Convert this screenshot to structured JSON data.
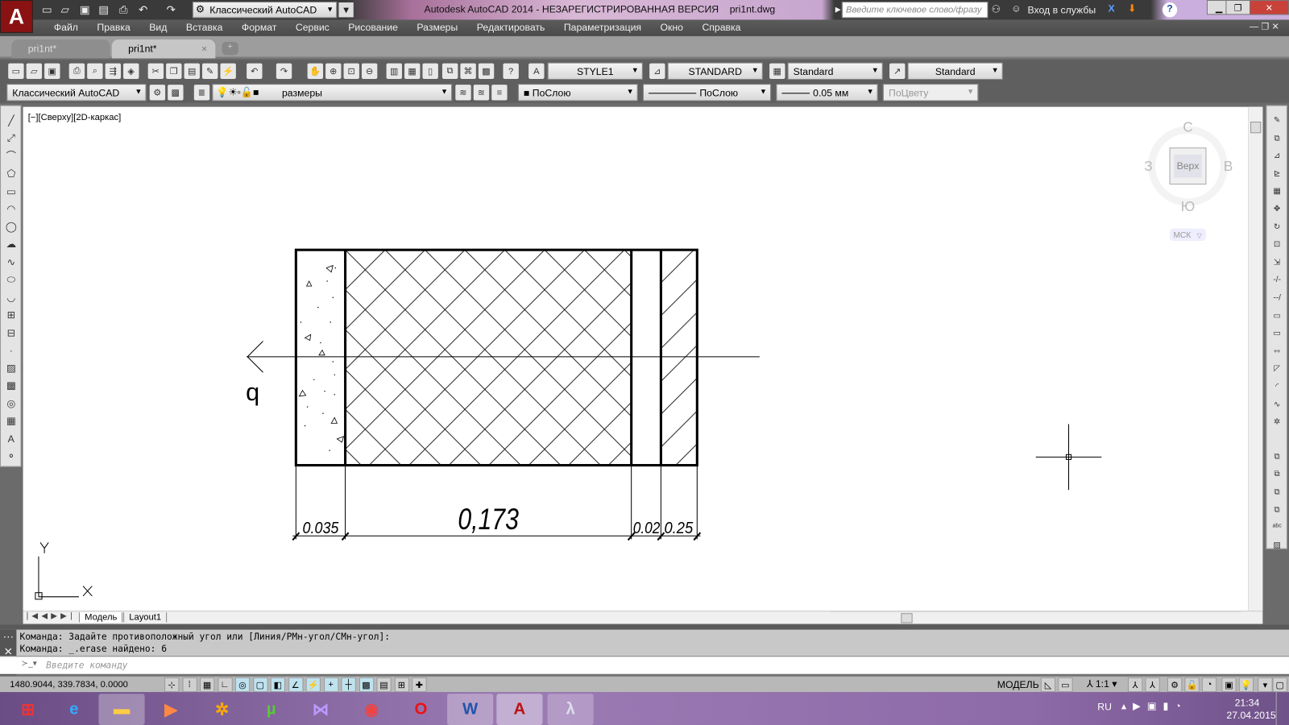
{
  "title_bar": {
    "workspace": "Классический AutoCAD",
    "window_title": "Autodesk AutoCAD 2014 - НЕЗАРЕГИСТРИРОВАННАЯ ВЕРСИЯ    pri1nt.dwg",
    "search_placeholder": "Введите ключевое слово/фразу",
    "sign_in": "Вход в службы",
    "help": "?"
  },
  "menu": [
    "Файл",
    "Правка",
    "Вид",
    "Вставка",
    "Формат",
    "Сервис",
    "Рисование",
    "Размеры",
    "Редактировать",
    "Параметризация",
    "Окно",
    "Справка"
  ],
  "doc_tabs": [
    {
      "label": "pri1nt*"
    },
    {
      "label": "pri1nt*",
      "close": "×"
    }
  ],
  "toolbar1": {
    "text_style": "STYLE1",
    "dim_style": "STANDARD",
    "table_style": "Standard",
    "mleader_style": "Standard"
  },
  "toolbar2": {
    "workspace": "Классический AutoCAD",
    "layer": "размеры",
    "color": "ПоСлою",
    "linetype": "ПоСлою",
    "lineweight": "0.05 мм",
    "plotstyle": "ПоЦвету"
  },
  "viewport": {
    "label": "[−][Сверху][2D-каркас]"
  },
  "viewcube": {
    "north": "С",
    "south": "Ю",
    "west": "З",
    "east": "В",
    "face": "Верх",
    "ucs": "МСК"
  },
  "drawing": {
    "flux_label": "q",
    "dims": [
      "0.035",
      "0,173",
      "0.02",
      "0.25"
    ],
    "ucs_x": "X",
    "ucs_y": "Y"
  },
  "layout_tabs": [
    "Модель",
    "Layout1"
  ],
  "command": {
    "history": [
      "Команда: Задайте противоположный угол или [Линия/РМн-угол/СМн-угол]:",
      "Команда: _.erase найдено: 6"
    ],
    "placeholder": "Введите команду"
  },
  "status": {
    "coords": "1480.9044, 339.7834, 0.0000",
    "model": "МОДЕЛЬ",
    "scale": "1:1"
  },
  "taskbar": {
    "lang": "RU",
    "time": "21:34",
    "date": "27.04.2015"
  },
  "icons": {
    "toolbar1": [
      "new-icon",
      "open-icon",
      "save-icon",
      "print-icon",
      "preview-icon",
      "publish-icon",
      "3dprint-icon",
      "cut-icon",
      "copy-icon",
      "paste-icon",
      "matchprop-icon",
      "blockedit-icon",
      "undo-icon",
      "redo-icon",
      "pan-icon",
      "zoom-realtime-icon",
      "zoom-window-icon",
      "zoom-previous-icon",
      "properties-icon",
      "designcenter-icon",
      "toolpalette-icon",
      "sheetset-icon",
      "markup-icon",
      "calculator-icon",
      "help-icon"
    ],
    "left": [
      "line-icon",
      "xline-icon",
      "pline-icon",
      "polygon-icon",
      "rectangle-icon",
      "arc-icon",
      "circle-icon",
      "revcloud-icon",
      "spline-icon",
      "ellipse-icon",
      "ellipse-arc-icon",
      "insert-block-icon",
      "make-block-icon",
      "point-icon",
      "hatch-icon",
      "gradient-icon",
      "region-icon",
      "table-icon",
      "mtext-icon",
      "addselected-icon"
    ],
    "right": [
      "erase-icon",
      "copy-object-icon",
      "mirror-icon",
      "offset-icon",
      "array-icon",
      "move-icon",
      "rotate-icon",
      "scale-icon",
      "stretch-icon",
      "trim-icon",
      "extend-icon",
      "break-point-icon",
      "break-icon",
      "join-icon",
      "chamfer-icon",
      "fillet-icon",
      "blend-icon",
      "explode-icon",
      "draworder-front-icon",
      "draworder-back-icon",
      "draworder-above-icon",
      "draworder-below-icon",
      "text-front-icon",
      "hatch-back-icon"
    ]
  }
}
